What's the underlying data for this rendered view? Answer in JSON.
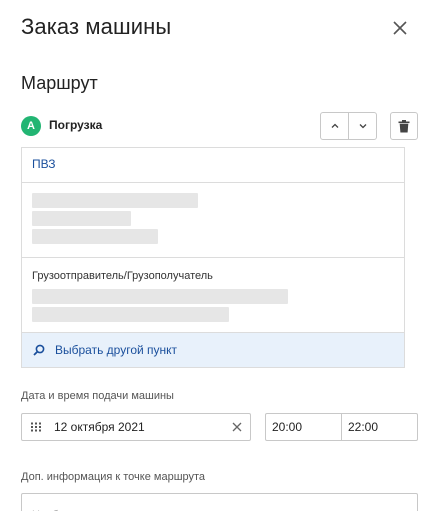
{
  "dialog": {
    "title": "Заказ машины"
  },
  "route": {
    "section_title": "Маршрут",
    "point": {
      "badge": "A",
      "label": "Погрузка",
      "badge_color": "#22b573",
      "address_tag": "ПВЗ",
      "consignor_label": "Грузоотправитель/Грузополучатель",
      "choose_other": "Выбрать другой пункт"
    }
  },
  "delivery": {
    "label": "Дата и время подачи машины",
    "date": "12 октября 2021",
    "time_from": "20:00",
    "time_to": "22:00"
  },
  "extra_info": {
    "label": "Доп. информация к точке маршрута",
    "placeholder": "Необязательно"
  },
  "icons": {
    "close": "close-icon",
    "up": "chevron-up-icon",
    "down": "chevron-down-icon",
    "trash": "trash-icon",
    "search": "search-icon",
    "calendar": "calendar-icon",
    "clear": "clear-icon"
  },
  "colors": {
    "accent": "#1a4f9c",
    "footer_bg": "#e8f1fb"
  }
}
